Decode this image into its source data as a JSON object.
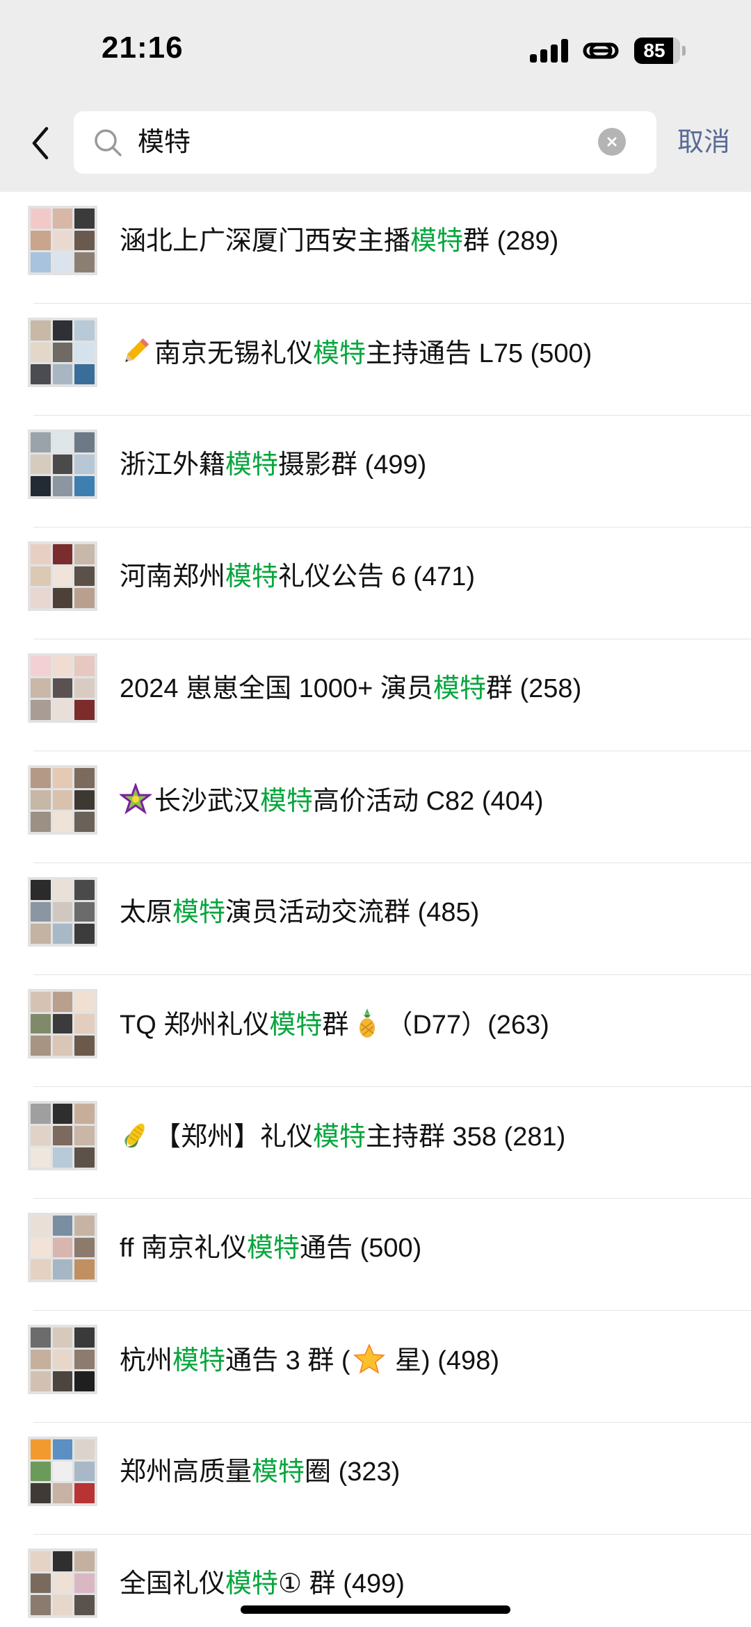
{
  "status_bar": {
    "time": "21:16",
    "battery": "85"
  },
  "search": {
    "query": "模特",
    "cancel_label": "取消"
  },
  "colors": {
    "highlight": "#07a63d",
    "cancel": "#576b95",
    "topbar_bg": "#ededed"
  },
  "results": [
    {
      "pre": "涵北上广深厦门西安主播",
      "hl": "模特",
      "post": "群 (289)",
      "emoji": ""
    },
    {
      "pre": "南京无锡礼仪",
      "hl": "模特",
      "post": "主持通告 L75 (500)",
      "emoji": "pencil-icon"
    },
    {
      "pre": "浙江外籍",
      "hl": "模特",
      "post": "摄影群 (499)",
      "emoji": ""
    },
    {
      "pre": "河南郑州",
      "hl": "模特",
      "post": "礼仪公告 6 (471)",
      "emoji": ""
    },
    {
      "pre": "2024 崽崽全国 1000+ 演员",
      "hl": "模特",
      "post": "群 (258)",
      "emoji": ""
    },
    {
      "pre": "长沙武汉",
      "hl": "模特",
      "post": "高价活动 C82 (404)",
      "emoji": "star-burst-icon"
    },
    {
      "pre": "太原",
      "hl": "模特",
      "post": "演员活动交流群 (485)",
      "emoji": ""
    },
    {
      "pre": "TQ 郑州礼仪",
      "hl": "模特",
      "post": "群",
      "post2": "（D77）(263)",
      "emoji": "",
      "emoji_after": "pineapple-icon"
    },
    {
      "pre": "【郑州】礼仪",
      "hl": "模特",
      "post": "主持群 358 (281)",
      "emoji": "corn-icon"
    },
    {
      "pre": "ff 南京礼仪",
      "hl": "模特",
      "post": "通告 (500)",
      "emoji": ""
    },
    {
      "pre": "杭州",
      "hl": "模特",
      "post": "通告 3 群 (",
      "post2": " 星) (498)",
      "emoji": "",
      "emoji_after": "star-icon"
    },
    {
      "pre": "郑州高质量",
      "hl": "模特",
      "post": "圈 (323)",
      "emoji": ""
    },
    {
      "pre": "全国礼仪",
      "hl": "模特",
      "post": "① 群 (499)",
      "emoji": ""
    }
  ]
}
